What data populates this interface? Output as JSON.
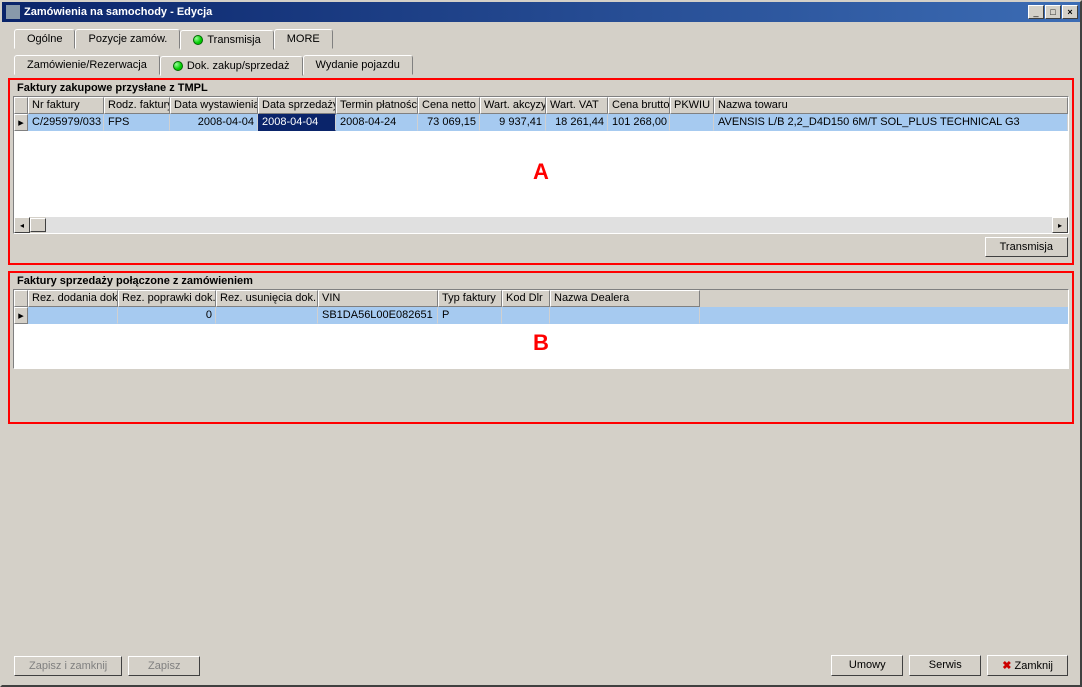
{
  "window": {
    "title": "Zamówienia na samochody - Edycja"
  },
  "tabs1": {
    "ogolne": "Ogólne",
    "pozycje": "Pozycje zamów.",
    "transmisja": "Transmisja",
    "more": "MORE"
  },
  "tabs2": {
    "zamrez": "Zamówienie/Rezerwacja",
    "dokzs": "Dok. zakup/sprzedaż",
    "wydanie": "Wydanie pojazdu"
  },
  "panelA": {
    "title": "Faktury zakupowe przysłane z TMPL",
    "headers": {
      "nr": "Nr faktury",
      "rodz": "Rodz. faktury",
      "dataw": "Data wystawienia",
      "datas": "Data sprzedaży",
      "termin": "Termin płatności",
      "netto": "Cena netto",
      "akcyza": "Wart. akcyzy",
      "vat": "Wart. VAT",
      "brutto": "Cena brutto",
      "pkwiu": "PKWIU",
      "towar": "Nazwa towaru"
    },
    "row": {
      "nr": "C/295979/033",
      "rodz": "FPS",
      "dataw": "2008-04-04",
      "datas": "2008-04-04",
      "termin": "2008-04-24",
      "netto": "73 069,15",
      "akcyza": "9 937,41",
      "vat": "18 261,44",
      "brutto": "101 268,00",
      "pkwiu": "",
      "towar": "AVENSIS L/B 2,2_D4D150 6M/T SOL_PLUS TECHNICAL G3"
    },
    "marker": "A",
    "btn": "Transmisja"
  },
  "panelB": {
    "title": "Faktury sprzedaży połączone z zamówieniem",
    "headers": {
      "dod": "Rez. dodania dok.",
      "popr": "Rez. poprawki dok.",
      "usun": "Rez. usunięcia dok.",
      "vin": "VIN",
      "typf": "Typ faktury",
      "kod": "Kod Dlr",
      "dealer": "Nazwa Dealera"
    },
    "row": {
      "dod": "",
      "popr": "0",
      "usun": "",
      "vin": "SB1DA56L00E082651",
      "typf": "P",
      "kod": "",
      "dealer": ""
    },
    "marker": "B"
  },
  "footer": {
    "zapiszi": "Zapisz i zamknij",
    "zapisz": "Zapisz",
    "umowy": "Umowy",
    "serwis": "Serwis",
    "zamknij": "Zamknij"
  }
}
